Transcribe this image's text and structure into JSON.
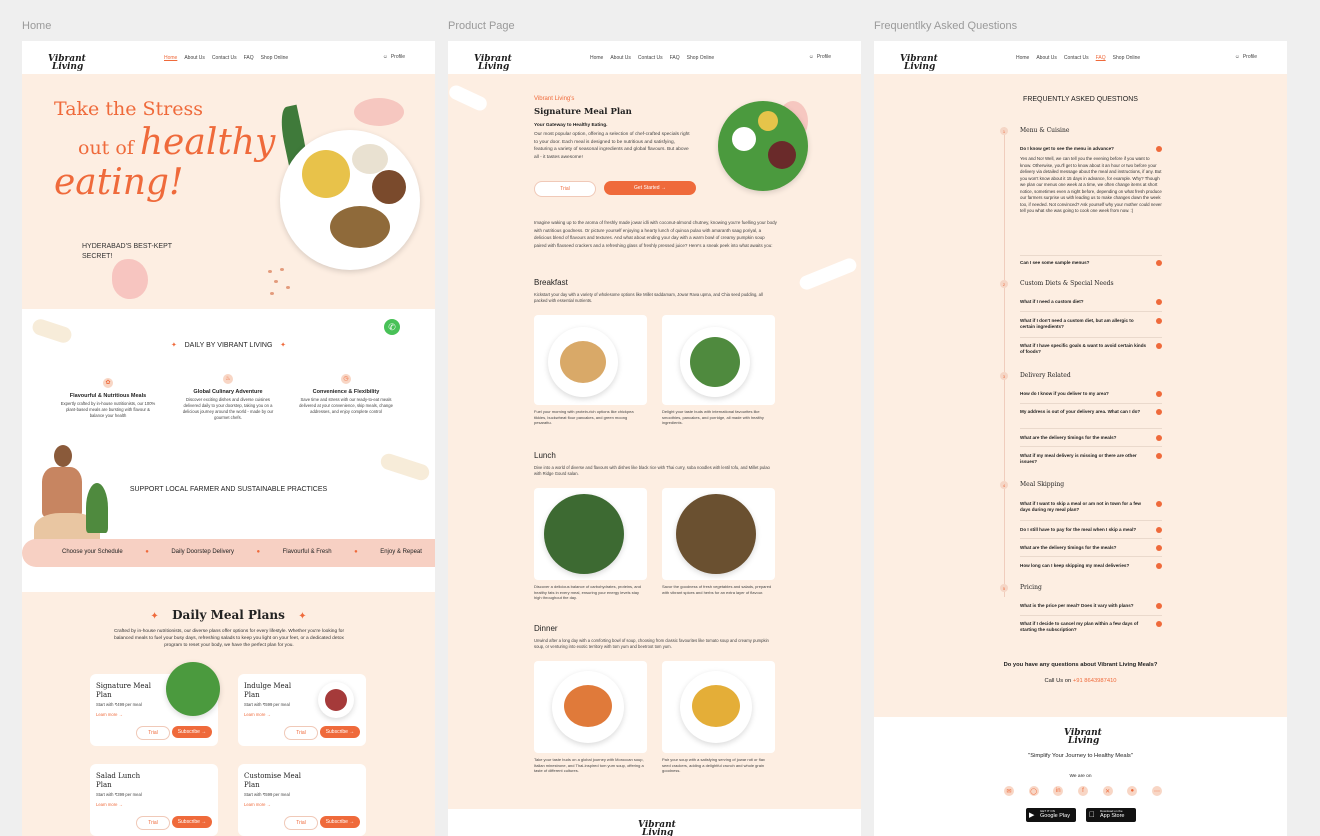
{
  "frames": {
    "home": "Home",
    "product": "Product Page",
    "faq": "Frequentlky Asked Questions"
  },
  "nav": {
    "logo_line1": "Vibrant",
    "logo_line2": "Living",
    "links": [
      "Home",
      "About Us",
      "Contact Us",
      "FAQ",
      "Shop Online"
    ],
    "profile": "Profile"
  },
  "home": {
    "hero_line1": "Take the Stress",
    "hero_line2a": "out of ",
    "hero_line2b": "healthy",
    "hero_line3": "eating!",
    "hero_sub": "HYDERABAD'S BEST-KEPT SECRET!",
    "daily_title": "DAILY BY VIBRANT LIVING",
    "features": [
      {
        "title": "Flavourful & Nutritious Meals",
        "text": "Expertly crafted by in-house nutritionists, our 100% plant-based meals are bursting with flavour & balance your health",
        "icon": "leaf-icon"
      },
      {
        "title": "Global Culinary Adventure",
        "text": "Discover exciting dishes and diverse cuisines delivered daily to your doorstep, taking you on a delicious journey around the world - made by our gourmet chefs.",
        "icon": "chef-hat-icon"
      },
      {
        "title": "Convenience & Flexibility",
        "text": "Save time and stress with our ready-to-eat meals delivered at your convenience, skip meals, change addresses, and enjoy complete control",
        "icon": "clock-icon"
      }
    ],
    "support": "SUPPORT LOCAL FARMER AND SUSTAINABLE PRACTICES",
    "steps": [
      "Choose your Schedule",
      "Daily Doorstep Delivery",
      "Flavourful & Fresh",
      "Enjoy & Repeat"
    ],
    "plans_title": "Daily Meal Plans",
    "plans_desc": "Crafted by in-house nutritionists, our diverse plans offer options for every lifestyle. Whether you're looking for balanced meals to fuel your busy days, refreshing salads to keep you light on your feet, or a dedicated detox program to reset your body, we have the perfect plan for you.",
    "plans": [
      {
        "name1": "Signature Meal",
        "name2": "Plan",
        "price": "Start with ₹499 per meal"
      },
      {
        "name1": "Indulge Meal",
        "name2": "Plan",
        "price": "Start with ₹599 per meal"
      },
      {
        "name1": "Salad Lunch",
        "name2": "Plan",
        "price": "Start with ₹399 per meal"
      },
      {
        "name1": "Customise Meal",
        "name2": "Plan",
        "price": "Start with ₹599 per meal"
      }
    ],
    "learn_more": "Learn more →",
    "trial": "Trial",
    "subscribe": "Subscribe →"
  },
  "product": {
    "brand": "Vibrant Living's",
    "title": "Signature Meal Plan",
    "tagline": "Your Gateway to Healthy Eating.",
    "intro": "Our most popular option, offering a selection of chef-crafted specials right to your door. Each meal is designed to be nutritious and satisfying, featuring a variety of seasonal ingredients and global flavours. But above all - it tastes awesome!",
    "trial": "Trial",
    "get_started": "Get Started →",
    "story": "Imagine waking up to the aroma of freshly made jowar idli with coconut-almond chutney, knowing you're fuelling your body with nutritious goodness. Or picture yourself enjoying a hearty lunch of quinoa pulao with amaranth saag poriyal, a delicious blend of flavours and textures. And what about ending your day with a warm bowl of creamy pumpkin soup paired with flaxseed crackers and a refreshing glass of freshly pressed juice? Here's a sneak peek into what awaits you:",
    "sections": [
      {
        "title": "Breakfast",
        "desc": "Kickstart your day with a variety of wholesome options like Millet saddamam, Jowar Rava upma, and Chia seed pudding, all packed with essential nutrients.",
        "captions": [
          "Fuel your morning with protein-rich options like chickpea tikkies, buckwheat flour pancakes, and green moong pesarattu.",
          "Delight your taste buds with international favourites like smoothies, pancakes, and porridge, all made with healthy ingredients."
        ]
      },
      {
        "title": "Lunch",
        "desc": "Dive into a world of diverse and flavours with dishes like black rice with Thai curry, soba noodles with lentil tofu, and Millet pulao with Ridge Gourd salan.",
        "captions": [
          "Discover a delicious balance of carbohydrates, proteins, and healthy fats in every meal, ensuring your energy levels stay high throughout the day.",
          "Savor the goodness of fresh vegetables and salads, prepared with vibrant spices and herbs for an extra layer of flavour."
        ]
      },
      {
        "title": "Dinner",
        "desc": "Unwind after a long day with a comforting bowl of soup, choosing from classic favourites like tomato soup and creamy pumpkin soup, or venturing into exotic territory with tom yum and beetroot tom yum.",
        "captions": [
          "Take your taste buds on a global journey with Moroccan soup, Italian minestrone, and Thai-inspired tom yum soup, offering a taste of different cultures.",
          "Pair your soup with a satisfying serving of jowar roti or flax seed crackers, adding a delightful crunch and whole grain goodness."
        ]
      }
    ]
  },
  "faq": {
    "title": "FREQUENTLY ASKED QUESTIONS",
    "categories": [
      {
        "num": "1",
        "name": "Menu & Cuisine"
      },
      {
        "num": "2",
        "name": "Custom Diets & Special Needs"
      },
      {
        "num": "3",
        "name": "Delivery Related"
      },
      {
        "num": "4",
        "name": "Meal Skipping"
      },
      {
        "num": "5",
        "name": "Pricing"
      }
    ],
    "open_q": "Do I know get to see the menu in advance?",
    "open_a": "Yes and No! Well, we can tell you the evening before if you want to know. Otherwise, you'll get to know about it an hour or two before your delivery via detailed message about the meal and instructions, if any. But you won't know about it 15 days in advance, for example. Why? Though we plan our menus one week at a time, we often change items at short notice, sometimes even a night before, depending on what fresh produce our farmers surprise us with leading us to make changes down the week too, if needed. Not convinced? Ask yourself why your mother could never tell you what she was going to cook one week from now. :)",
    "questions": [
      "Can I see some sample menus?",
      "What if I need a custom diet?",
      "What if I don't need a custom diet, but am allergic to certain ingredients?",
      "What if I have specific goals & want to avoid certain kinds of foods?",
      "How do I know if you deliver to my area?",
      "My address is out of your delivery area. What can I do?",
      "What are the delivery timings for the meals?",
      "What if my meal delivery is missing or there are other issues?",
      "What if I want to skip a meal or am not in town for a few days during my meal plan?",
      "Do I still have to pay for the meal when I skip a meal?",
      "What are the delivery timings for the meals?",
      "How long can I keep skipping my meal deliveries?",
      "What is the price per meal? Does it vary with plans?",
      "What if I decide to cancel my plan within a few days of starting the subscription?"
    ],
    "contact_q": "Do you have any questions about Vibrant Living Meals?",
    "call_us": "Call Us on",
    "phone": "+91 8643987410",
    "slogan": "\"Simplify Your Journey to Healthy Meals\"",
    "we_are_on": "We are on",
    "social_icons": [
      "mail-icon",
      "instagram-icon",
      "linkedin-icon",
      "facebook-icon",
      "x-icon",
      "location-icon",
      "more-icon"
    ],
    "google_play_small": "GET IT ON",
    "google_play": "Google Play",
    "app_store_small": "Download on the",
    "app_store": "App Store"
  },
  "colors": {
    "accent": "#ef6a3b",
    "cream": "#fdeee2",
    "peach": "#f7d0c3"
  }
}
